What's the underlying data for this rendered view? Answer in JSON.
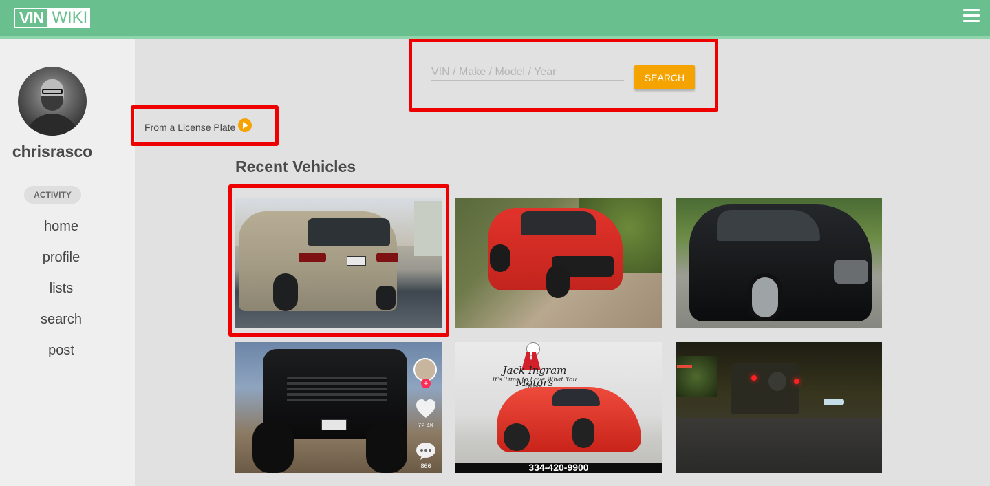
{
  "header": {
    "logo_part1": "VIN",
    "logo_part2": "WIKI",
    "menu_icon": "hamburger-menu-icon"
  },
  "sidebar": {
    "username": "chrisrasco",
    "activity_label": "ACTIVITY",
    "nav": [
      {
        "label": "home"
      },
      {
        "label": "profile"
      },
      {
        "label": "lists"
      },
      {
        "label": "search"
      },
      {
        "label": "post"
      }
    ]
  },
  "search": {
    "placeholder": "VIN / Make / Model / Year",
    "value": "",
    "button_label": "SEARCH"
  },
  "license_plate": {
    "label": "From a License Plate",
    "icon": "play-circle-icon"
  },
  "recent": {
    "title": "Recent Vehicles",
    "vehicles": [
      {
        "image": "silver-suv-rear-photo"
      },
      {
        "image": "red-compact-suv-photo"
      },
      {
        "image": "black-suv-photo"
      },
      {
        "image": "black-lifted-truck-photo",
        "likes": "72.4K",
        "comments": "866"
      },
      {
        "image": "red-sports-car-dealer-photo",
        "dealer": "Jack Ingram Motors",
        "tagline": "It's Time to Love What You Drive.",
        "phone": "334-420-9900"
      },
      {
        "image": "night-street-jeep-photo"
      }
    ]
  },
  "colors": {
    "header": "#69c08e",
    "accent": "#f5a300",
    "highlight": "#ee0000",
    "background": "#e1e1e1"
  }
}
